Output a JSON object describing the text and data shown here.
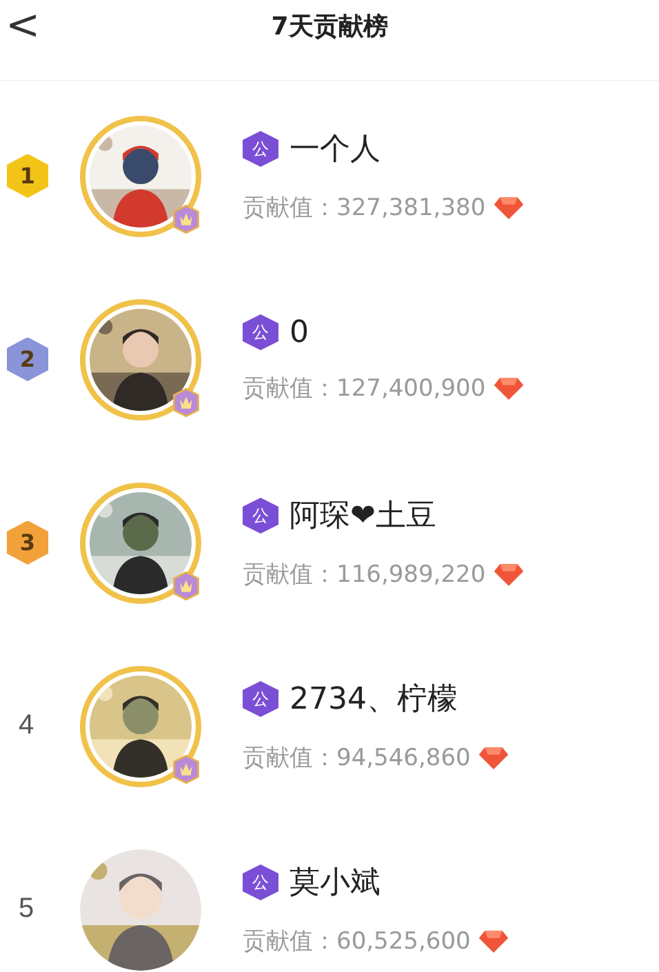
{
  "header": {
    "back": "<",
    "title": "7天贡献榜"
  },
  "rows": [
    {
      "rank": "1",
      "kind": "medal",
      "color": "#f2c418",
      "ring": true,
      "crown": true,
      "badge": "公",
      "name": "一个人",
      "label": "贡献值：",
      "value": "327,381,380"
    },
    {
      "rank": "2",
      "kind": "medal",
      "color": "#8a94d8",
      "ring": true,
      "crown": true,
      "badge": "公",
      "name": "0",
      "label": "贡献值：",
      "value": "127,400,900"
    },
    {
      "rank": "3",
      "kind": "medal",
      "color": "#f2a03a",
      "ring": true,
      "crown": true,
      "badge": "公",
      "name": "阿琛❤土豆",
      "label": "贡献值：",
      "value": "116,989,220"
    },
    {
      "rank": "4",
      "kind": "plain",
      "ring": true,
      "crown": true,
      "badge": "公",
      "name": "2734、柠檬",
      "label": "贡献值：",
      "value": "94,546,860"
    },
    {
      "rank": "5",
      "kind": "plain",
      "ring": false,
      "crown": false,
      "badge": "公",
      "name": "莫小斌",
      "label": "贡献值：",
      "value": "60,525,600"
    }
  ]
}
